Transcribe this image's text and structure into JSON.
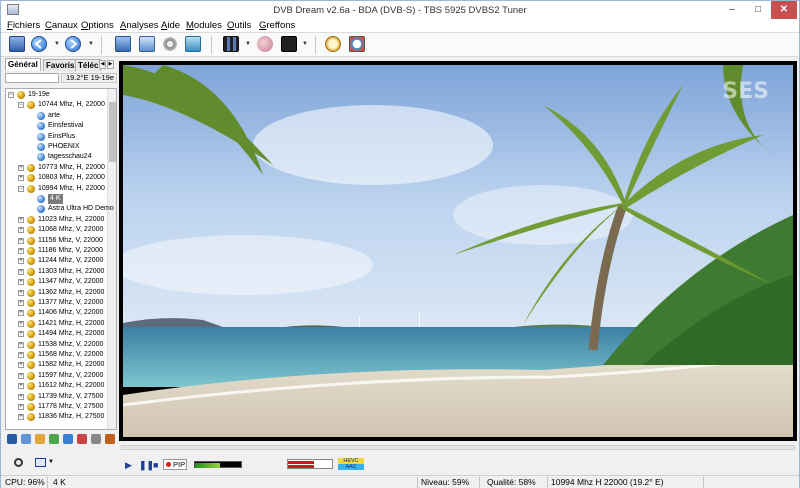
{
  "window": {
    "title": "DVB Dream v2.6a - BDA (DVB-S) - TBS 5925 DVBS2 Tuner",
    "controls": [
      "minimize",
      "maximize",
      "close"
    ]
  },
  "menu": [
    "Fichiers",
    "Canaux",
    "Options",
    "Analyses",
    "Aide",
    "Modules",
    "Outils",
    "Greffons"
  ],
  "toolbar": {
    "icons": [
      "tv-icon",
      "back-icon",
      "forward-icon",
      "screen-icon",
      "window-icon",
      "settings-icon",
      "film-icon",
      "record-icon",
      "capture-icon",
      "clock-icon",
      "timer-icon"
    ]
  },
  "sidebar": {
    "tabs": [
      "Général",
      "Favoris",
      "Téléc"
    ],
    "position": "19.2°E 19-19e",
    "tree": [
      {
        "label": "19-19e",
        "level": 0,
        "type": "satellite",
        "expanded": true
      },
      {
        "label": "10744 Mhz, H, 22000",
        "level": 1,
        "type": "transponder",
        "expanded": true
      },
      {
        "label": "arte",
        "level": 2,
        "type": "channel"
      },
      {
        "label": "Einsfestival",
        "level": 2,
        "type": "channel"
      },
      {
        "label": "EinsPlus",
        "level": 2,
        "type": "channel"
      },
      {
        "label": "PHOENIX",
        "level": 2,
        "type": "channel"
      },
      {
        "label": "tagesschau24",
        "level": 2,
        "type": "channel"
      },
      {
        "label": "10773 Mhz, H, 22000",
        "level": 1,
        "type": "transponder",
        "expanded": false
      },
      {
        "label": "10803 Mhz, H, 22000",
        "level": 1,
        "type": "transponder",
        "expanded": false
      },
      {
        "label": "10994 Mhz, H, 22000",
        "level": 1,
        "type": "transponder",
        "expanded": true
      },
      {
        "label": "4 K",
        "level": 2,
        "type": "channel",
        "selected": true
      },
      {
        "label": "Astra Ultra HD Demo",
        "level": 2,
        "type": "channel"
      },
      {
        "label": "11023 Mhz, H, 22000",
        "level": 1,
        "type": "transponder",
        "expanded": false
      },
      {
        "label": "11068 Mhz, V, 22000",
        "level": 1,
        "type": "transponder",
        "expanded": false
      },
      {
        "label": "11156 Mhz, V, 22000",
        "level": 1,
        "type": "transponder",
        "expanded": false
      },
      {
        "label": "11186 Mhz, V, 22000",
        "level": 1,
        "type": "transponder",
        "expanded": false
      },
      {
        "label": "11244 Mhz, V, 22000",
        "level": 1,
        "type": "transponder",
        "expanded": false
      },
      {
        "label": "11303 Mhz, H, 22000",
        "level": 1,
        "type": "transponder",
        "expanded": false
      },
      {
        "label": "11347 Mhz, V, 22000",
        "level": 1,
        "type": "transponder",
        "expanded": false
      },
      {
        "label": "11362 Mhz, H, 22000",
        "level": 1,
        "type": "transponder",
        "expanded": false
      },
      {
        "label": "11377 Mhz, V, 22000",
        "level": 1,
        "type": "transponder",
        "expanded": false
      },
      {
        "label": "11406 Mhz, V, 22000",
        "level": 1,
        "type": "transponder",
        "expanded": false
      },
      {
        "label": "11421 Mhz, H, 22000",
        "level": 1,
        "type": "transponder",
        "expanded": false
      },
      {
        "label": "11494 Mhz, H, 22000",
        "level": 1,
        "type": "transponder",
        "expanded": false
      },
      {
        "label": "11538 Mhz, V, 22000",
        "level": 1,
        "type": "transponder",
        "expanded": false
      },
      {
        "label": "11568 Mhz, V, 22000",
        "level": 1,
        "type": "transponder",
        "expanded": false
      },
      {
        "label": "11582 Mhz, H, 22000",
        "level": 1,
        "type": "transponder",
        "expanded": false
      },
      {
        "label": "11597 Mhz, V, 22000",
        "level": 1,
        "type": "transponder",
        "expanded": false
      },
      {
        "label": "11612 Mhz, H, 22000",
        "level": 1,
        "type": "transponder",
        "expanded": false
      },
      {
        "label": "11739 Mhz, V, 27500",
        "level": 1,
        "type": "transponder",
        "expanded": false
      },
      {
        "label": "11778 Mhz, V, 27500",
        "level": 1,
        "type": "transponder",
        "expanded": false
      },
      {
        "label": "11836 Mhz, H, 27500",
        "level": 1,
        "type": "transponder",
        "expanded": false
      }
    ]
  },
  "video": {
    "watermark": "SES"
  },
  "player": {
    "pip_label": "PIP",
    "audio_level": 0.55,
    "signal_level": 0.59,
    "quality_level": 0.58,
    "video_codec": "HEVC",
    "audio_codec": "AAC"
  },
  "status": {
    "cpu": "CPU: 96%",
    "channel": "4 K",
    "level": "Niveau: 59%",
    "quality": "Qualité: 58%",
    "tuning": "10994 Mhz  H  22000  (19.2° E)"
  },
  "colors": {
    "close_button": "#c75050",
    "selection": "#7a7a7a",
    "hevc_badge": "#f1d93a",
    "aac_badge": "#38b3ec"
  }
}
